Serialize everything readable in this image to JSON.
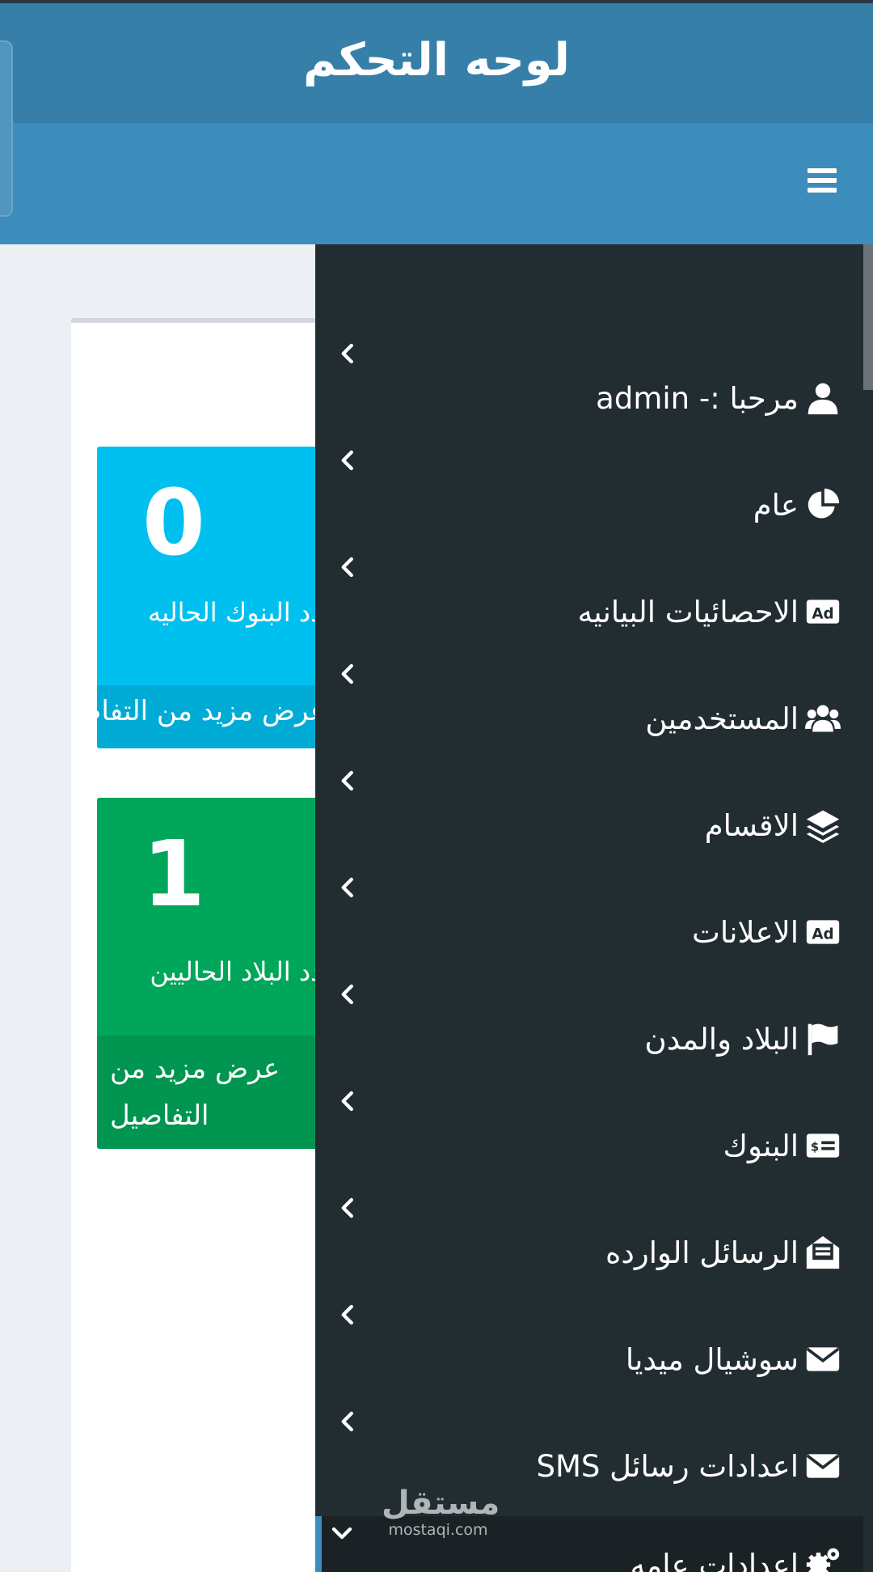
{
  "header": {
    "title": "لوحه التحكم"
  },
  "stats": [
    {
      "count": "0",
      "label": "عدد البنوك الحاليه",
      "footer": "عرض مزيد من التفاصيل",
      "color": "#00c0ef"
    },
    {
      "count": "1",
      "label": "عدد البلاد الحاليين",
      "footer": "عرض مزيد من التفاصيل",
      "color": "#00a65a"
    }
  ],
  "sidebar": {
    "items": [
      {
        "label": "مرحبا :- admin",
        "icon": "user-icon"
      },
      {
        "label": "عام",
        "icon": "pie-chart-icon"
      },
      {
        "label": "الاحصائيات البيانيه",
        "icon": "ad-icon"
      },
      {
        "label": "المستخدمين",
        "icon": "users-icon"
      },
      {
        "label": "الاقسام",
        "icon": "layers-icon"
      },
      {
        "label": "الاعلانات",
        "icon": "ad-icon"
      },
      {
        "label": "البلاد والمدن",
        "icon": "flag-icon"
      },
      {
        "label": "البنوك",
        "icon": "money-check-icon"
      },
      {
        "label": "الرسائل الوارده",
        "icon": "envelope-open-icon"
      },
      {
        "label": "سوشيال ميديا",
        "icon": "envelope-icon"
      },
      {
        "label": "اعدادات رسائل SMS",
        "icon": "envelope-icon"
      },
      {
        "label": "اعدادات عامه",
        "icon": "cogs-icon"
      }
    ]
  },
  "watermark": {
    "arabic": "مستقل",
    "latin": "mostaqi.com"
  }
}
